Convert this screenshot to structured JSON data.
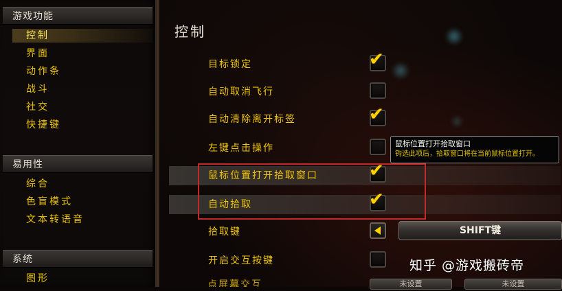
{
  "sidebar": {
    "sections": [
      {
        "header": "游戏功能",
        "items": [
          "控制",
          "界面",
          "动作条",
          "战斗",
          "社交",
          "快捷键"
        ],
        "selected": "控制"
      },
      {
        "header": "易用性",
        "items": [
          "综合",
          "色盲模式",
          "文本转语音"
        ]
      },
      {
        "header": "系统",
        "items": [
          "图形"
        ]
      }
    ]
  },
  "main": {
    "title": "控制",
    "rows": [
      {
        "label": "目标锁定",
        "checked": true
      },
      {
        "label": "自动取消飞行",
        "checked": false
      },
      {
        "label": "自动清除离开标签",
        "checked": true
      },
      {
        "label": "左键点击操作",
        "checked": false
      },
      {
        "label": "鼠标位置打开拾取窗口",
        "checked": true
      },
      {
        "label": "自动拾取",
        "checked": true
      },
      {
        "label": "拾取键",
        "value": "SHIFT键"
      },
      {
        "label": "开启交互按键",
        "checked": false
      },
      {
        "label": "点屏幕交互"
      }
    ],
    "check_glyph": "✔",
    "tooltip": {
      "title": "鼠标位置打开拾取窗口",
      "text": "钩选此项后，拾取窗口将在当前鼠标位置打开。"
    },
    "bottom_buttons": [
      "未设置",
      "未设置"
    ]
  },
  "watermark": "知乎 @游戏搬砖帝",
  "colors": {
    "label_yellow": "#f0c700",
    "check_yellow": "#ffd200",
    "highlight_red": "#c22a2a"
  }
}
